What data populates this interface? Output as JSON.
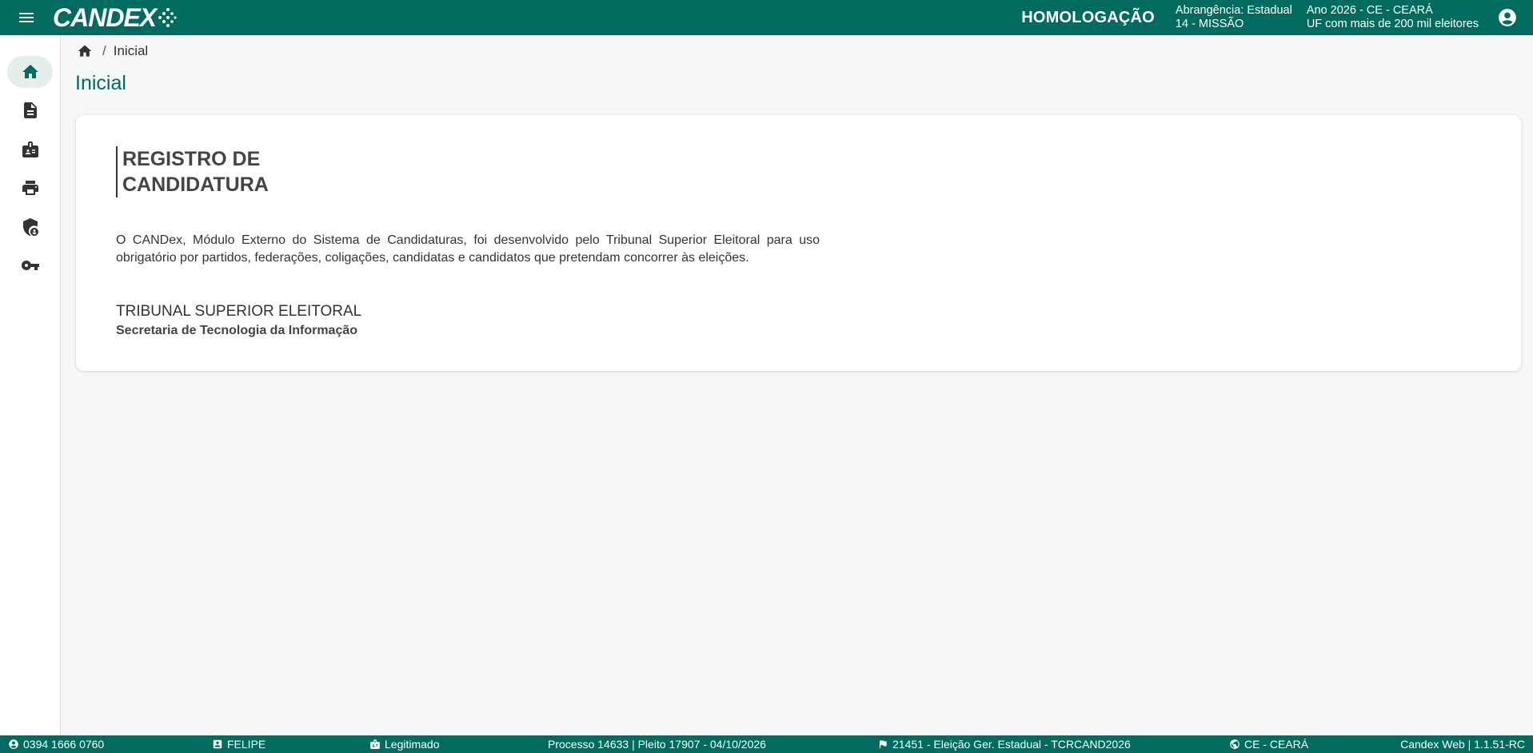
{
  "header": {
    "logo_text": "CANDEX",
    "environment": "HOMOLOGAÇÃO",
    "scope_line1": "Abrangência: Estadual",
    "scope_line2": "14 - MISSÃO",
    "election_line1": "Ano 2026 - CE - CEARÁ",
    "election_line2": "UF com mais de 200 mil eleitores",
    "color": "#006b5e"
  },
  "sidebar": {
    "items": [
      {
        "icon": "home-icon",
        "active": true
      },
      {
        "icon": "document-icon",
        "active": false
      },
      {
        "icon": "badge-icon",
        "active": false
      },
      {
        "icon": "print-icon",
        "active": false
      },
      {
        "icon": "security-icon",
        "active": false
      },
      {
        "icon": "key-icon",
        "active": false
      }
    ]
  },
  "breadcrumb": {
    "current": "Inicial"
  },
  "page": {
    "title": "Inicial"
  },
  "card": {
    "heading_line1": "REGISTRO DE",
    "heading_line2": "CANDIDATURA",
    "description": "O CANDex, Módulo Externo do Sistema de Candidaturas, foi desenvolvido pelo Tribunal Superior Eleitoral para uso obrigatório por partidos, federações, coligações, candidatas e candidatos que pretendam concorrer às eleições.",
    "org_name": "TRIBUNAL SUPERIOR ELEITORAL",
    "org_sub": "Secretaria de Tecnologia da Informação"
  },
  "statusbar": {
    "user_code": "0394 1666 0760",
    "user_name": "FELIPE",
    "role": "Legitimado",
    "process": "Processo 14633 | Pleito 17907 - 04/10/2026",
    "election": "21451 - Eleição Ger. Estadual - TCRCAND2026",
    "location": "CE - CEARÁ",
    "version": "Candex Web | 1.1.51-RC"
  }
}
